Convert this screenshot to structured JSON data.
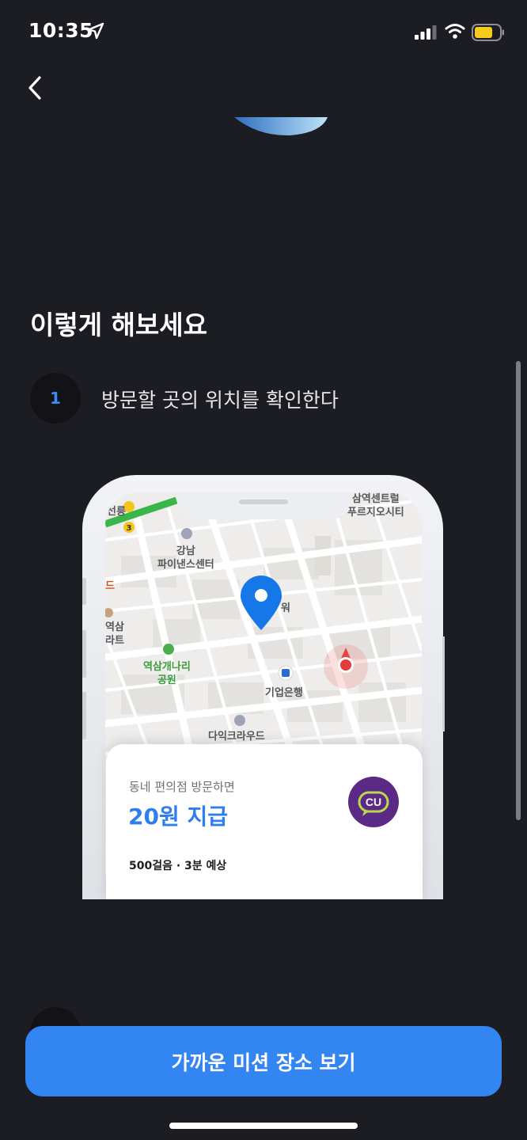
{
  "status_bar": {
    "time": "10:35"
  },
  "section": {
    "title": "이렇게 해보세요",
    "steps": [
      {
        "number": "1",
        "text": "방문할 곳의 위치를 확인한다"
      }
    ]
  },
  "mockup": {
    "map_labels": {
      "gangnam_finance": "강남\n파이낸스센터",
      "yeoksam_park": "역삼개나리\n공원",
      "ibk_bank": "기업은행",
      "daiq_cloud": "다익크라우드",
      "yeoksam_center": "삼역센트럴\n푸르지오시티",
      "yeoksam_frag": "역삼\n라트",
      "tower_frag": "워",
      "station_frag": "선릉",
      "line_num": "3",
      "left_frag": "드"
    },
    "card": {
      "subtitle": "동네 편의점 방문하면",
      "amount": "20원 지급",
      "meta": "500걸음 · 3분 예상",
      "logo_text": "CU"
    }
  },
  "cta": {
    "label": "가까운 미션 장소 보기"
  },
  "colors": {
    "accent": "#3385f2",
    "background": "#1c1c23",
    "amount": "#2f7ef0",
    "cu_purple": "#5b2a86"
  },
  "icons": [
    "location-arrow-icon",
    "signal-icon",
    "wifi-icon",
    "battery-icon",
    "back-chevron-icon",
    "map-pin-icon",
    "current-location-icon"
  ]
}
